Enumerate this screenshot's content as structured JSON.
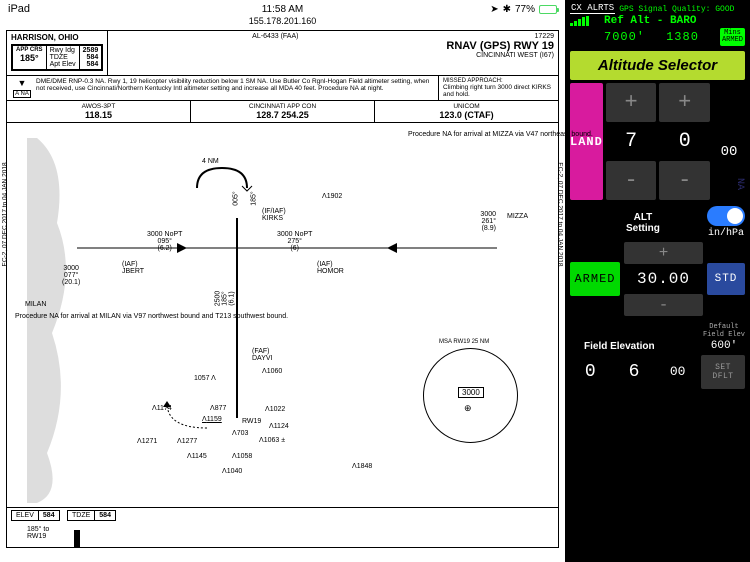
{
  "status": {
    "device": "iPad",
    "time": "11:58 AM",
    "ip": "155.178.201.160",
    "bt_icon": "bluetooth-icon",
    "battery_pct": "77%"
  },
  "chart": {
    "location": "HARRISON, OHIO",
    "al_code": "AL-6433 (FAA)",
    "chart_num": "17229",
    "title": "RNAV (GPS) RWY 19",
    "subtitle": "CINCINNATI WEST (I67)",
    "app_crs_label": "APP CRS",
    "app_crs": "185°",
    "rwy_ldg_label": "Rwy Idg",
    "rwy_ldg": "2589",
    "tdze_label": "TDZE",
    "tdze": "584",
    "apt_elev_label": "Apt Elev",
    "apt_elev": "584",
    "na_symbol": "▼",
    "na_label": "NA",
    "notes": "DME/DME RNP-0.3 NA.  Rwy 1, 19 helicopter visibility reduction below 1 SM NA. Use Butler Co Rgnl-Hogan Field altimeter setting, when not received, use Cincinnati/Northern Kentucky Intl altimeter setting and increase all MDA 40 feet. Procedure NA at night.",
    "missed_label": "MISSED APPROACH:",
    "missed": "Climbing right turn 3000 direct KIRKS and hold.",
    "freq": [
      {
        "name": "AWOS-3PT",
        "val": "118.15"
      },
      {
        "name": "CINCINNATI APP CON",
        "val": "128.7   254.25"
      },
      {
        "name": "UNICOM",
        "val": "123.0 (CTAF)"
      }
    ],
    "edge_text": "EC-2,  07 DEC 2017  to  04 JAN 2018",
    "plan": {
      "note_ne": "Procedure NA for arrival at MIZZA via V47 northeast bound.",
      "note_sw": "Procedure NA for arrival at MILAN via V97 northwest bound and T213 southwest bound.",
      "four_nm": "4 NM",
      "kirks": "(IF/IAF)\nKIRKS",
      "nineteen02": "1902",
      "mizza": "MIZZA",
      "mizza_data": "3000\n261°\n(8.9)",
      "homor": "(IAF)\nHOMOR",
      "homor_data": "3000 NoPT\n275°\n(6)",
      "jbert": "(IAF)\nJBERT",
      "jbert_data": "3000 NoPT\n095°\n(6.2)",
      "milan": "MILAN",
      "milan_data": "3000\n077°\n(20.1)",
      "crs185a": "185°",
      "crs005": "005°",
      "leg25": "2500\n185°\n(6.1)",
      "dayvi": "(FAF)\nDAYVI",
      "alt1060": "1060",
      "alt1057": "1057",
      "alt1174": "1174",
      "alt877": "877",
      "alt1159": "1159",
      "rw19": "RW19",
      "alt703": "703",
      "alt1022": "1022",
      "alt1124": "1124",
      "alt1063": "1063 ±",
      "alt1271": "1271",
      "alt1277": "1277",
      "alt1145": "1145",
      "alt1058": "1058",
      "alt1040": "1040",
      "alt1848": "1848",
      "msa_label": "MSA RW19 25 NM",
      "msa_val": "3000"
    },
    "profile": {
      "elev_label": "ELEV",
      "elev": "584",
      "tdze_label": "TDZE",
      "tdze": "584",
      "rwy_note": "185° to\nRW19"
    }
  },
  "panel": {
    "cx_alerts": "CX ALRTS",
    "gps_quality": "GPS Signal Quality: GOOD",
    "ref_alt": "Ref Alt - BARO",
    "readout_alt": "7000'",
    "readout_baro": "1380",
    "mins_armed": "Mins\nARMED",
    "alt_selector": "Altitude Selector",
    "land": "LAND",
    "digit1": "7",
    "digit2": "0",
    "digit3": "00",
    "na": "NA",
    "alt_setting_label": "ALT\nSetting",
    "unit": "in/hPa",
    "armed": "ARMED",
    "baro": "30.00",
    "std": "STD",
    "fe_label": "Field Elevation",
    "fe_default_label": "Default\nField Elev",
    "fe_default": "600'",
    "fe1": "0",
    "fe2": "6",
    "fe3": "00",
    "set_dflt": "SET DFLT"
  }
}
